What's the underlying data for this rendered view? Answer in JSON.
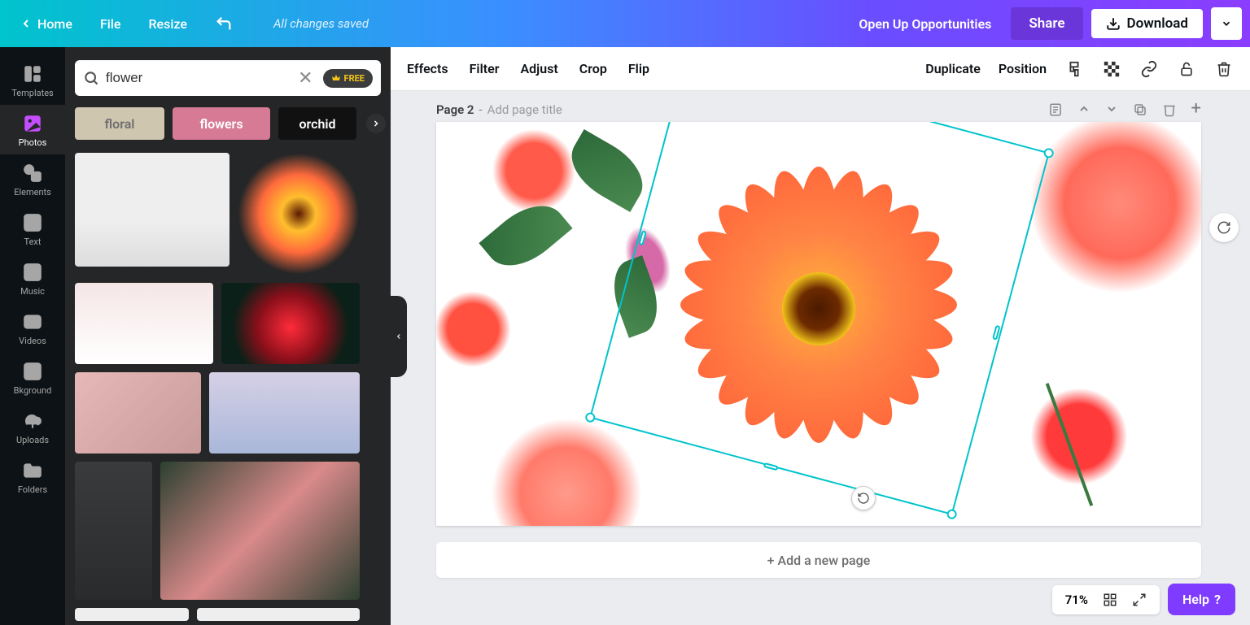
{
  "topbar": {
    "home": "Home",
    "file": "File",
    "resize": "Resize",
    "status": "All changes saved",
    "opportunities": "Open Up Opportunities",
    "share": "Share",
    "download": "Download"
  },
  "rail": [
    {
      "id": "templates",
      "label": "Templates"
    },
    {
      "id": "photos",
      "label": "Photos"
    },
    {
      "id": "elements",
      "label": "Elements"
    },
    {
      "id": "text",
      "label": "Text"
    },
    {
      "id": "music",
      "label": "Music"
    },
    {
      "id": "videos",
      "label": "Videos"
    },
    {
      "id": "bkground",
      "label": "Bkground"
    },
    {
      "id": "uploads",
      "label": "Uploads"
    },
    {
      "id": "folders",
      "label": "Folders"
    }
  ],
  "search": {
    "value": "flower",
    "placeholder": "Search",
    "free": "FREE"
  },
  "chips": [
    "floral",
    "flowers",
    "orchid"
  ],
  "context": {
    "effects": "Effects",
    "filter": "Filter",
    "adjust": "Adjust",
    "crop": "Crop",
    "flip": "Flip",
    "duplicate": "Duplicate",
    "position": "Position"
  },
  "page": {
    "label": "Page 2",
    "separator": " - ",
    "titlePlaceholder": "Add page title",
    "addNew": "+ Add a new page"
  },
  "zoom": {
    "value": "71%"
  },
  "help": "Help"
}
